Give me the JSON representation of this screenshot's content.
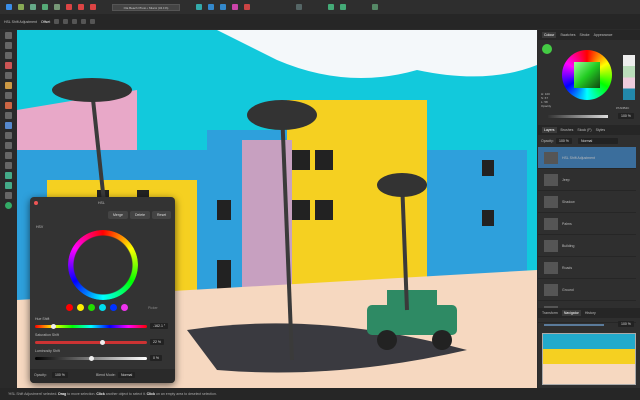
{
  "window": {
    "title": "Ola Beach Photo • Miami (34.1%)"
  },
  "context_bar": {
    "label": "HSL Shift Adjustment",
    "mode": "Offset"
  },
  "hsl_dialog": {
    "title": "HSL",
    "buttons": {
      "merge": "Merge",
      "delete": "Delete",
      "reset": "Reset"
    },
    "hsl_checkbox": "HSV",
    "picker": "Picker",
    "hue_label": "Hue Shift",
    "hue_value": "-162.1 °",
    "hue_fraction": 0.15,
    "saturation_label": "Saturation Shift",
    "saturation_value": "22 %",
    "saturation_fraction": 0.61,
    "luminosity_label": "Luminosity Shift",
    "luminosity_value": "0 %",
    "luminosity_fraction": 0.5,
    "opacity_label": "Opacity:",
    "opacity_value": "100 %",
    "blend_label": "Blend Mode:",
    "blend_value": "Normal",
    "swatches": [
      "#ff0000",
      "#ffee00",
      "#22dd00",
      "#00ddee",
      "#0033ff",
      "#ee33ee"
    ]
  },
  "colour_panel": {
    "tabs": [
      "Colour",
      "Swatches",
      "Stroke",
      "Appearance"
    ],
    "hex": "#7ADB4C",
    "opacity_label": "Opacity",
    "opacity_value": "100 %",
    "hsl_readout": [
      "H: 100",
      "S: 67",
      "L: 58"
    ]
  },
  "layers_panel": {
    "tabs": [
      "Layers",
      "Brushes",
      "Stock (F)",
      "Styles"
    ],
    "opacity_label": "Opacity:",
    "opacity_value": "100 %",
    "blend": "Normal",
    "layers": [
      "HSL Shift Adjustment",
      "Jeep",
      "Shadow",
      "Palms",
      "Building",
      "Roads",
      "Ground",
      "Sky"
    ]
  },
  "navigator_panel": {
    "tabs": [
      "Transform",
      "Navigator",
      "History"
    ],
    "zoom": "100 %"
  },
  "status": {
    "prefix": "'HSL Shift Adjustment' selected.",
    "drag": "Drag",
    "t1": "to move selection.",
    "click1": "Click",
    "t2": "another object to select it.",
    "click2": "Click",
    "t3": "on an empty area to deselect selection."
  },
  "colors": {
    "accent": "#3b6e9c",
    "sky": "#12c9dc",
    "yellow": "#f5d021",
    "pink": "#e8a8c8",
    "blue": "#2ea0dc"
  }
}
